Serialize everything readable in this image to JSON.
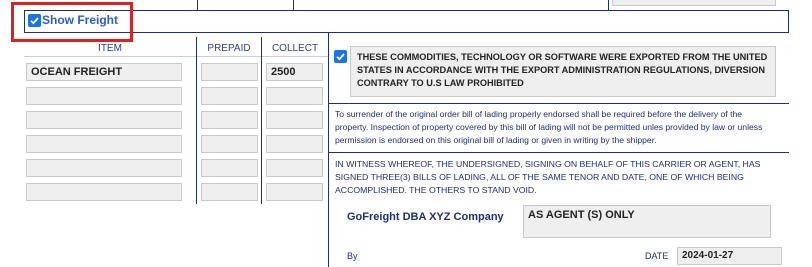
{
  "show_freight": {
    "label": "Show Freight",
    "checked": true
  },
  "freight_table": {
    "headers": {
      "item": "ITEM",
      "prepaid": "PREPAID",
      "collect": "COLLECT"
    },
    "rows": [
      {
        "item": "OCEAN FREIGHT",
        "prepaid": "",
        "collect": "2500"
      },
      {
        "item": "",
        "prepaid": "",
        "collect": ""
      },
      {
        "item": "",
        "prepaid": "",
        "collect": ""
      },
      {
        "item": "",
        "prepaid": "",
        "collect": ""
      },
      {
        "item": "",
        "prepaid": "",
        "collect": ""
      },
      {
        "item": "",
        "prepaid": "",
        "collect": ""
      }
    ]
  },
  "export_notice": {
    "checked": true,
    "text": "THESE COMMODITIES, TECHNOLOGY OR SOFTWARE WERE EXPORTED FROM THE UNITED STATES IN ACCORDANCE WITH THE EXPORT ADMINISTRATION REGULATIONS, DIVERSION CONTRARY TO U.S LAW PROHIBITED"
  },
  "surrender_text": "To surrender of the original order bill of lading properly endorsed shall be required before the delivery of the property. Inspection of property covered by this bill of lading will not be permitted unles provided by law or unless permission is endorsed on this original bill of lading or given in writing by the shipper.",
  "witness_text": "IN WITNESS WHEREOF, THE UNDERSIGNED, SIGNING ON BEHALF OF THIS CARRIER OR AGENT, HAS SIGNED THREE(3) BILLS OF LADING, ALL OF THE SAME TENOR AND DATE, ONE OF WHICH BEING ACCOMPLISHED. THE OTHERS TO STAND VOID.",
  "signature": {
    "company": "GoFreight DBA XYZ Company",
    "agent_value": "AS AGENT (S) ONLY",
    "by_label": "By",
    "date_label": "DATE",
    "date_value": "2024-01-27"
  },
  "colors": {
    "navy": "#1f2f7a",
    "checkbox_blue": "#1a73e8",
    "highlight_red": "#e02020",
    "field_bg": "#efefef"
  }
}
